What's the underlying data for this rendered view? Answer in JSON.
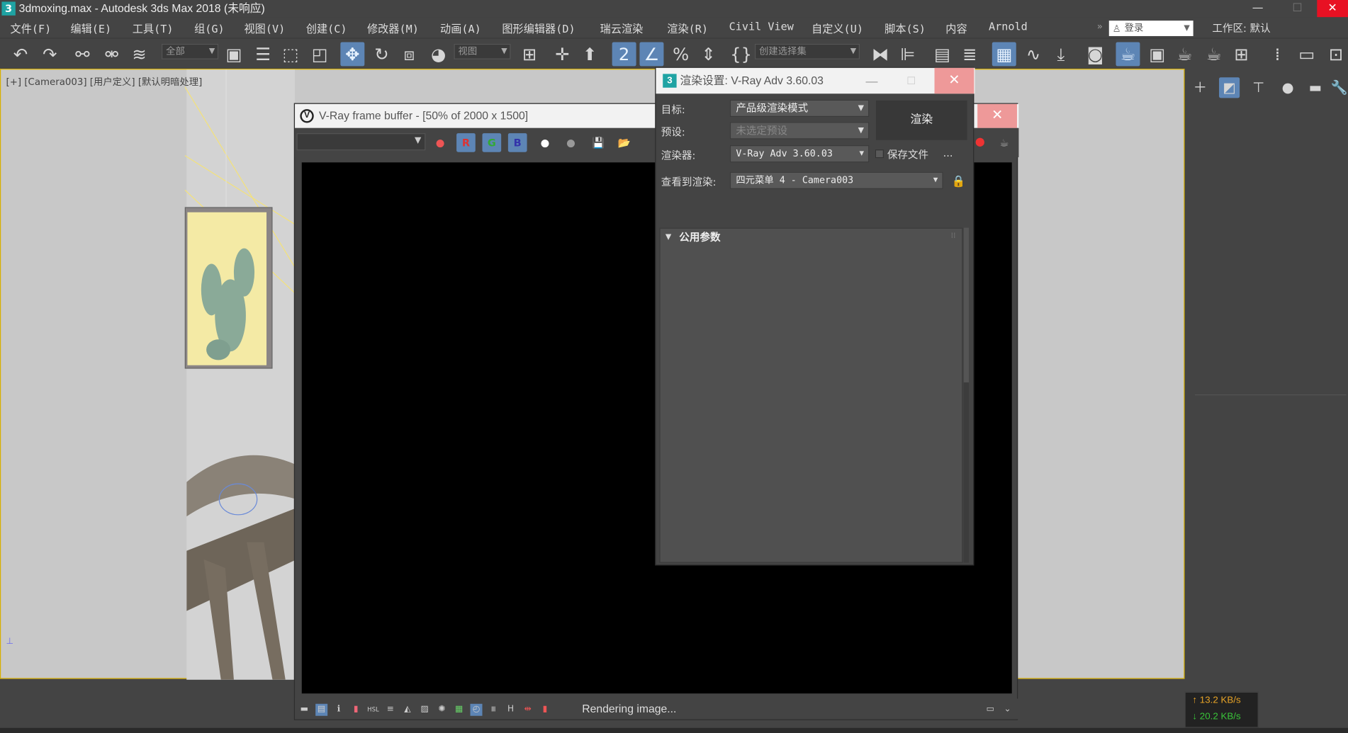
{
  "app": {
    "icon": "3",
    "title": "3dmoxing.max - Autodesk 3ds Max 2018  (未响应)"
  },
  "menubar": {
    "items": [
      "文件(F)",
      "编辑(E)",
      "工具(T)",
      "组(G)",
      "视图(V)",
      "创建(C)",
      "修改器(M)",
      "动画(A)",
      "图形编辑器(D)",
      "瑞云渲染",
      "渲染(R)",
      "Civil View",
      "自定义(U)",
      "脚本(S)",
      "内容",
      "Arnold"
    ],
    "login_placeholder": "登录",
    "workspace_label": "工作区: 默认"
  },
  "toolbar": {
    "selection_filter": "全部",
    "reference_coord": "视图",
    "named_selection": "创建选择集"
  },
  "viewport": {
    "label": "[+] [Camera003] [用户定义] [默认明暗处理]"
  },
  "vfb": {
    "title": "V-Ray frame buffer - [50% of 2000 x 1500]",
    "logo": "V",
    "status": "Rendering image...",
    "channel_buttons": {
      "r": "R",
      "g": "G",
      "b": "B"
    }
  },
  "render_setup": {
    "icon": "3",
    "title": "渲染设置: V-Ray Adv 3.60.03",
    "target_label": "目标:",
    "target_value": "产品级渲染模式",
    "preset_label": "预设:",
    "preset_value": "未选定预设",
    "renderer_label": "渲染器:",
    "renderer_value": "V-Ray Adv 3.60.03",
    "save_file_label": "保存文件",
    "more_label": "...",
    "view_label": "查看到渲染:",
    "view_value": "四元菜单 4 - Camera003",
    "render_button": "渲染",
    "section_title": "公用参数"
  },
  "net": {
    "up": "↑ 13.2 KB/s",
    "down": "↓ 20.2 KB/s"
  },
  "colors": {
    "accent": "#5d85b5",
    "close": "#e81123",
    "viewport_border": "#d8b000"
  }
}
